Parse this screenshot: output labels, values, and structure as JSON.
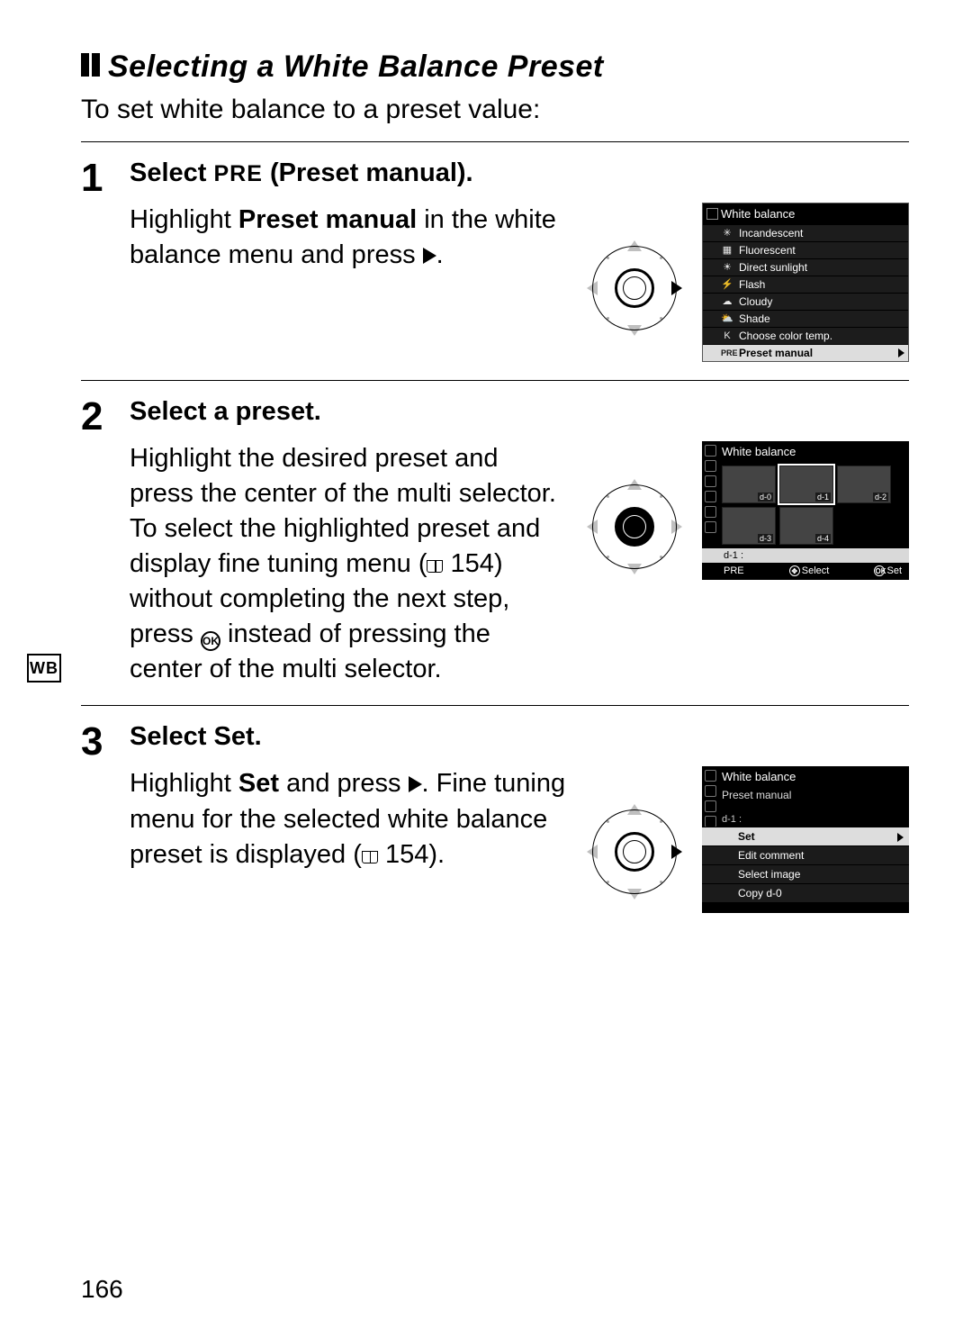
{
  "section_title": "Selecting a White Balance Preset",
  "intro": "To set white balance to a preset value:",
  "side_tab": "WB",
  "page_number": "166",
  "xref_page": "154",
  "steps": [
    {
      "num": "1",
      "heading_pre": "Select ",
      "heading_tag": "PRE",
      "heading_post": " (Preset manual).",
      "text_pre": "Highlight ",
      "text_bold": "Preset manual",
      "text_post": " in the white balance menu and press ",
      "text_end": "."
    },
    {
      "num": "2",
      "heading": "Select a preset.",
      "text_a": "Highlight the desired preset and press the center of the multi selector.  To select the highlighted preset and display fine tuning menu (",
      "text_b": ") without completing the next step, press ",
      "text_c": " instead of pressing the center of the multi selector."
    },
    {
      "num": "3",
      "heading": "Select Set.",
      "text_pre": "Highlight ",
      "text_bold": "Set",
      "text_mid": " and press ",
      "text_after": ". Fine tuning menu for the selected white balance preset is displayed (",
      "text_end": ")."
    }
  ],
  "lcd1": {
    "title": "White balance",
    "items": [
      {
        "icon": "✳",
        "label": "Incandescent"
      },
      {
        "icon": "▦",
        "label": "Fluorescent"
      },
      {
        "icon": "☀",
        "label": "Direct sunlight"
      },
      {
        "icon": "⚡",
        "label": "Flash"
      },
      {
        "icon": "☁",
        "label": "Cloudy"
      },
      {
        "icon": "⛅",
        "label": "Shade"
      },
      {
        "icon": "K",
        "label": "Choose color temp."
      }
    ],
    "highlight": {
      "icon": "PRE",
      "label": "Preset manual"
    }
  },
  "lcd2": {
    "title": "White balance",
    "thumbs": [
      "d-0",
      "d-1",
      "d-2",
      "d-3",
      "d-4"
    ],
    "selected_thumb": 1,
    "info": "d-1  :",
    "foot_left": "PRE",
    "foot_mid": "Select",
    "foot_right": "Set",
    "foot_mid_icon": "✥",
    "foot_right_icon": "OK"
  },
  "lcd3": {
    "title": "White balance",
    "sub": "Preset manual",
    "label": "d-1     :",
    "options": [
      "Set",
      "Edit comment",
      "Select image",
      "Copy d-0"
    ],
    "highlight_index": 0
  }
}
